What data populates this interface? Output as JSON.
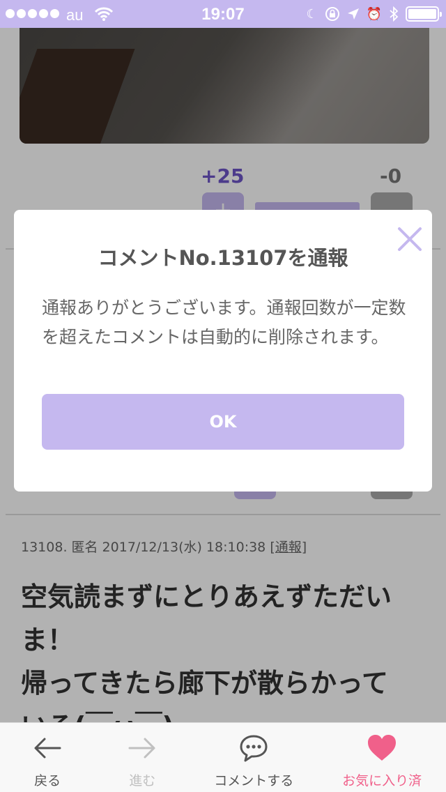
{
  "status_bar": {
    "carrier": "au",
    "time": "19:07"
  },
  "post": {
    "vote_up_count": "+25",
    "vote_down_count": "-0",
    "vote_plus_symbol": "+",
    "vote_up_ratio": 1.0
  },
  "comment": {
    "meta": "13108. 匿名 2017/12/13(水) 18:10:38 ",
    "report_link": "[通報]",
    "lines": [
      "空気読まずにとりあえずただい",
      "ま！",
      "帰ってきたら廊下が散らかって",
      "いる(￣ω￣)"
    ]
  },
  "dialog": {
    "title": "コメントNo.13107を通報",
    "message": "通報ありがとうございます。通報回数が一定数を超えたコメントは自動的に削除されます。",
    "ok_label": "OK",
    "close_icon": "close-icon"
  },
  "tab_bar": {
    "back_label": "戻る",
    "forward_label": "進む",
    "comment_label": "コメントする",
    "favorite_label": "お気に入り済"
  },
  "colors": {
    "accent": "#c5b8ef",
    "favorite": "#f0608a",
    "vote_up": "#6e55c8"
  }
}
